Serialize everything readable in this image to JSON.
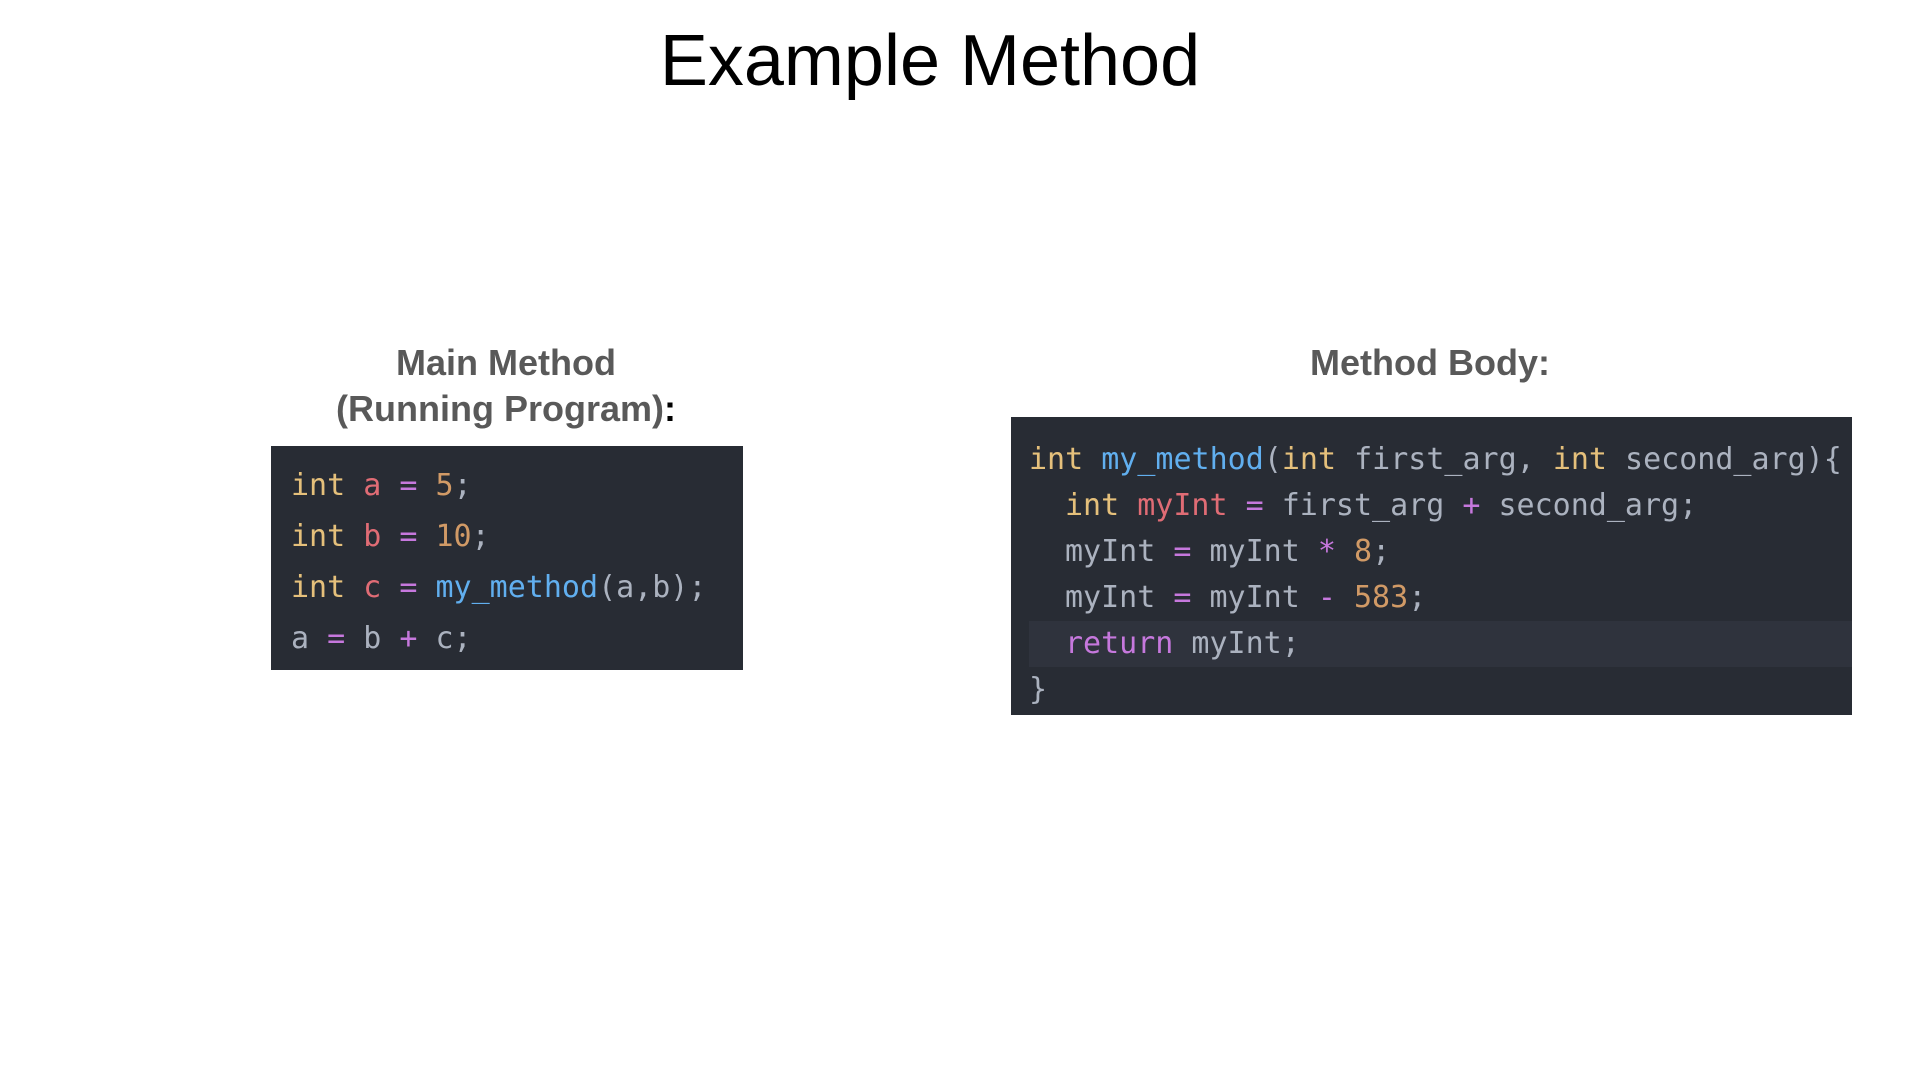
{
  "slide": {
    "title": "Example Method"
  },
  "main_method": {
    "label_line1": "Main Method",
    "label_line2": "(Running Program)",
    "label_colon": ":",
    "lines": [
      [
        {
          "t": "int",
          "c": "keyword"
        },
        {
          "t": " ",
          "c": "plain"
        },
        {
          "t": "a",
          "c": "variable"
        },
        {
          "t": " ",
          "c": "plain"
        },
        {
          "t": "=",
          "c": "operator"
        },
        {
          "t": " ",
          "c": "plain"
        },
        {
          "t": "5",
          "c": "number"
        },
        {
          "t": ";",
          "c": "plain"
        }
      ],
      [
        {
          "t": "int",
          "c": "keyword"
        },
        {
          "t": " ",
          "c": "plain"
        },
        {
          "t": "b",
          "c": "variable"
        },
        {
          "t": " ",
          "c": "plain"
        },
        {
          "t": "=",
          "c": "operator"
        },
        {
          "t": " ",
          "c": "plain"
        },
        {
          "t": "10",
          "c": "number"
        },
        {
          "t": ";",
          "c": "plain"
        }
      ],
      [
        {
          "t": "int",
          "c": "keyword"
        },
        {
          "t": " ",
          "c": "plain"
        },
        {
          "t": "c",
          "c": "variable"
        },
        {
          "t": " ",
          "c": "plain"
        },
        {
          "t": "=",
          "c": "operator"
        },
        {
          "t": " ",
          "c": "plain"
        },
        {
          "t": "my_method",
          "c": "function"
        },
        {
          "t": "(a,b);",
          "c": "plain"
        }
      ],
      [
        {
          "t": "a",
          "c": "plain"
        },
        {
          "t": " ",
          "c": "plain"
        },
        {
          "t": "=",
          "c": "operator"
        },
        {
          "t": " b ",
          "c": "plain"
        },
        {
          "t": "+",
          "c": "operator"
        },
        {
          "t": " c;",
          "c": "plain"
        }
      ]
    ]
  },
  "method_body": {
    "label": "Method Body",
    "label_colon": ":",
    "highlighted_line": 4,
    "lines": [
      {
        "indent": 0,
        "tokens": [
          {
            "t": "int",
            "c": "keyword"
          },
          {
            "t": " ",
            "c": "plain"
          },
          {
            "t": "my_method",
            "c": "function"
          },
          {
            "t": "(",
            "c": "plain"
          },
          {
            "t": "int",
            "c": "keyword"
          },
          {
            "t": " first_arg, ",
            "c": "plain"
          },
          {
            "t": "int",
            "c": "keyword"
          },
          {
            "t": " second_arg){",
            "c": "plain"
          }
        ]
      },
      {
        "indent": 1,
        "tokens": [
          {
            "t": "int",
            "c": "keyword"
          },
          {
            "t": " ",
            "c": "plain"
          },
          {
            "t": "myInt",
            "c": "variable"
          },
          {
            "t": " ",
            "c": "plain"
          },
          {
            "t": "=",
            "c": "operator"
          },
          {
            "t": " first_arg ",
            "c": "plain"
          },
          {
            "t": "+",
            "c": "operator"
          },
          {
            "t": " second_arg;",
            "c": "plain"
          }
        ]
      },
      {
        "indent": 1,
        "tokens": [
          {
            "t": "myInt ",
            "c": "plain"
          },
          {
            "t": "=",
            "c": "operator"
          },
          {
            "t": " myInt ",
            "c": "plain"
          },
          {
            "t": "*",
            "c": "operator"
          },
          {
            "t": " ",
            "c": "plain"
          },
          {
            "t": "8",
            "c": "number"
          },
          {
            "t": ";",
            "c": "plain"
          }
        ]
      },
      {
        "indent": 1,
        "tokens": [
          {
            "t": "myInt ",
            "c": "plain"
          },
          {
            "t": "=",
            "c": "operator"
          },
          {
            "t": " myInt ",
            "c": "plain"
          },
          {
            "t": "-",
            "c": "operator"
          },
          {
            "t": " ",
            "c": "plain"
          },
          {
            "t": "583",
            "c": "number"
          },
          {
            "t": ";",
            "c": "plain"
          }
        ]
      },
      {
        "indent": 1,
        "tokens": [
          {
            "t": "return",
            "c": "return"
          },
          {
            "t": " myInt;",
            "c": "plain"
          }
        ]
      },
      {
        "indent": 0,
        "tokens": [
          {
            "t": "}",
            "c": "plain"
          }
        ]
      }
    ]
  },
  "syntax_colors": {
    "keyword": "#e5c07b",
    "variable": "#e06c75",
    "operator": "#c678dd",
    "number": "#d19a66",
    "function": "#61afef",
    "return": "#c678dd",
    "plain": "#abb2bf"
  },
  "theme": {
    "code_background": "#282c34",
    "highlight_line_background": "#2f333d",
    "label_color": "#595959"
  }
}
